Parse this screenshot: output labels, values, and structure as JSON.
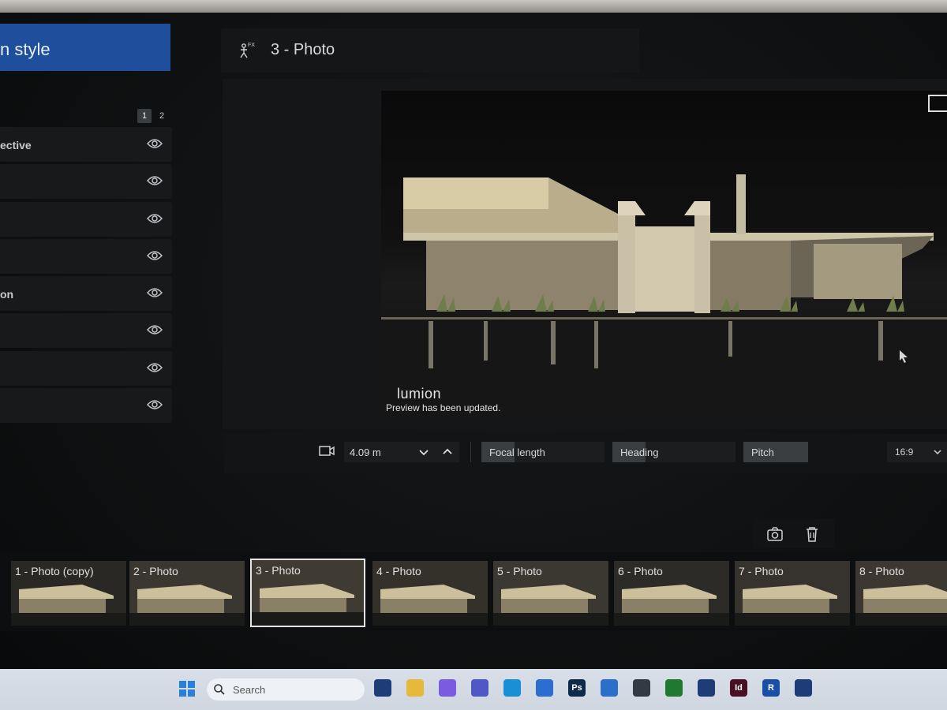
{
  "app": {
    "name": "Lumion"
  },
  "left_panel": {
    "title": "n style",
    "pages": [
      "1",
      "2"
    ],
    "effects": [
      {
        "label": "ective"
      },
      {
        "label": ""
      },
      {
        "label": ""
      },
      {
        "label": ""
      },
      {
        "label": "on"
      },
      {
        "label": ""
      },
      {
        "label": ""
      },
      {
        "label": ""
      }
    ]
  },
  "header": {
    "title": "3 - Photo"
  },
  "preview": {
    "logo": "lumion",
    "status": "Preview has been updated."
  },
  "camera_bar": {
    "distance": "4.09 m",
    "focal_length_label": "Focal length",
    "heading_label": "Heading",
    "pitch_label": "Pitch",
    "aspect_ratio": "16:9",
    "focal_length_level": 0.27,
    "heading_level": 0.27,
    "pitch_level": 1.0
  },
  "filmstrip": {
    "selected_index": 2,
    "photos": [
      {
        "label": "1 - Photo (copy)"
      },
      {
        "label": "2 - Photo"
      },
      {
        "label": "3 - Photo"
      },
      {
        "label": "4 - Photo"
      },
      {
        "label": "5 - Photo"
      },
      {
        "label": "6 - Photo"
      },
      {
        "label": "7 - Photo"
      },
      {
        "label": "8 - Photo"
      }
    ]
  },
  "taskbar": {
    "search_placeholder": "Search",
    "apps": [
      {
        "icon": "lumion-icon"
      },
      {
        "icon": "file-explorer-icon"
      },
      {
        "icon": "copilot-icon"
      },
      {
        "icon": "teams-icon"
      },
      {
        "icon": "edge-icon"
      },
      {
        "icon": "autodesk-icon"
      },
      {
        "icon": "photoshop-icon",
        "text": "Ps"
      },
      {
        "icon": "store-icon"
      },
      {
        "icon": "sketchup-icon"
      },
      {
        "icon": "xbox-icon"
      },
      {
        "icon": "lumion-icon"
      },
      {
        "icon": "indesign-icon",
        "text": "Id"
      },
      {
        "icon": "revit-icon",
        "text": "R"
      },
      {
        "icon": "lumion-icon"
      }
    ]
  },
  "colors": {
    "accent": "#1f4f9c",
    "panel": "#17191b"
  }
}
